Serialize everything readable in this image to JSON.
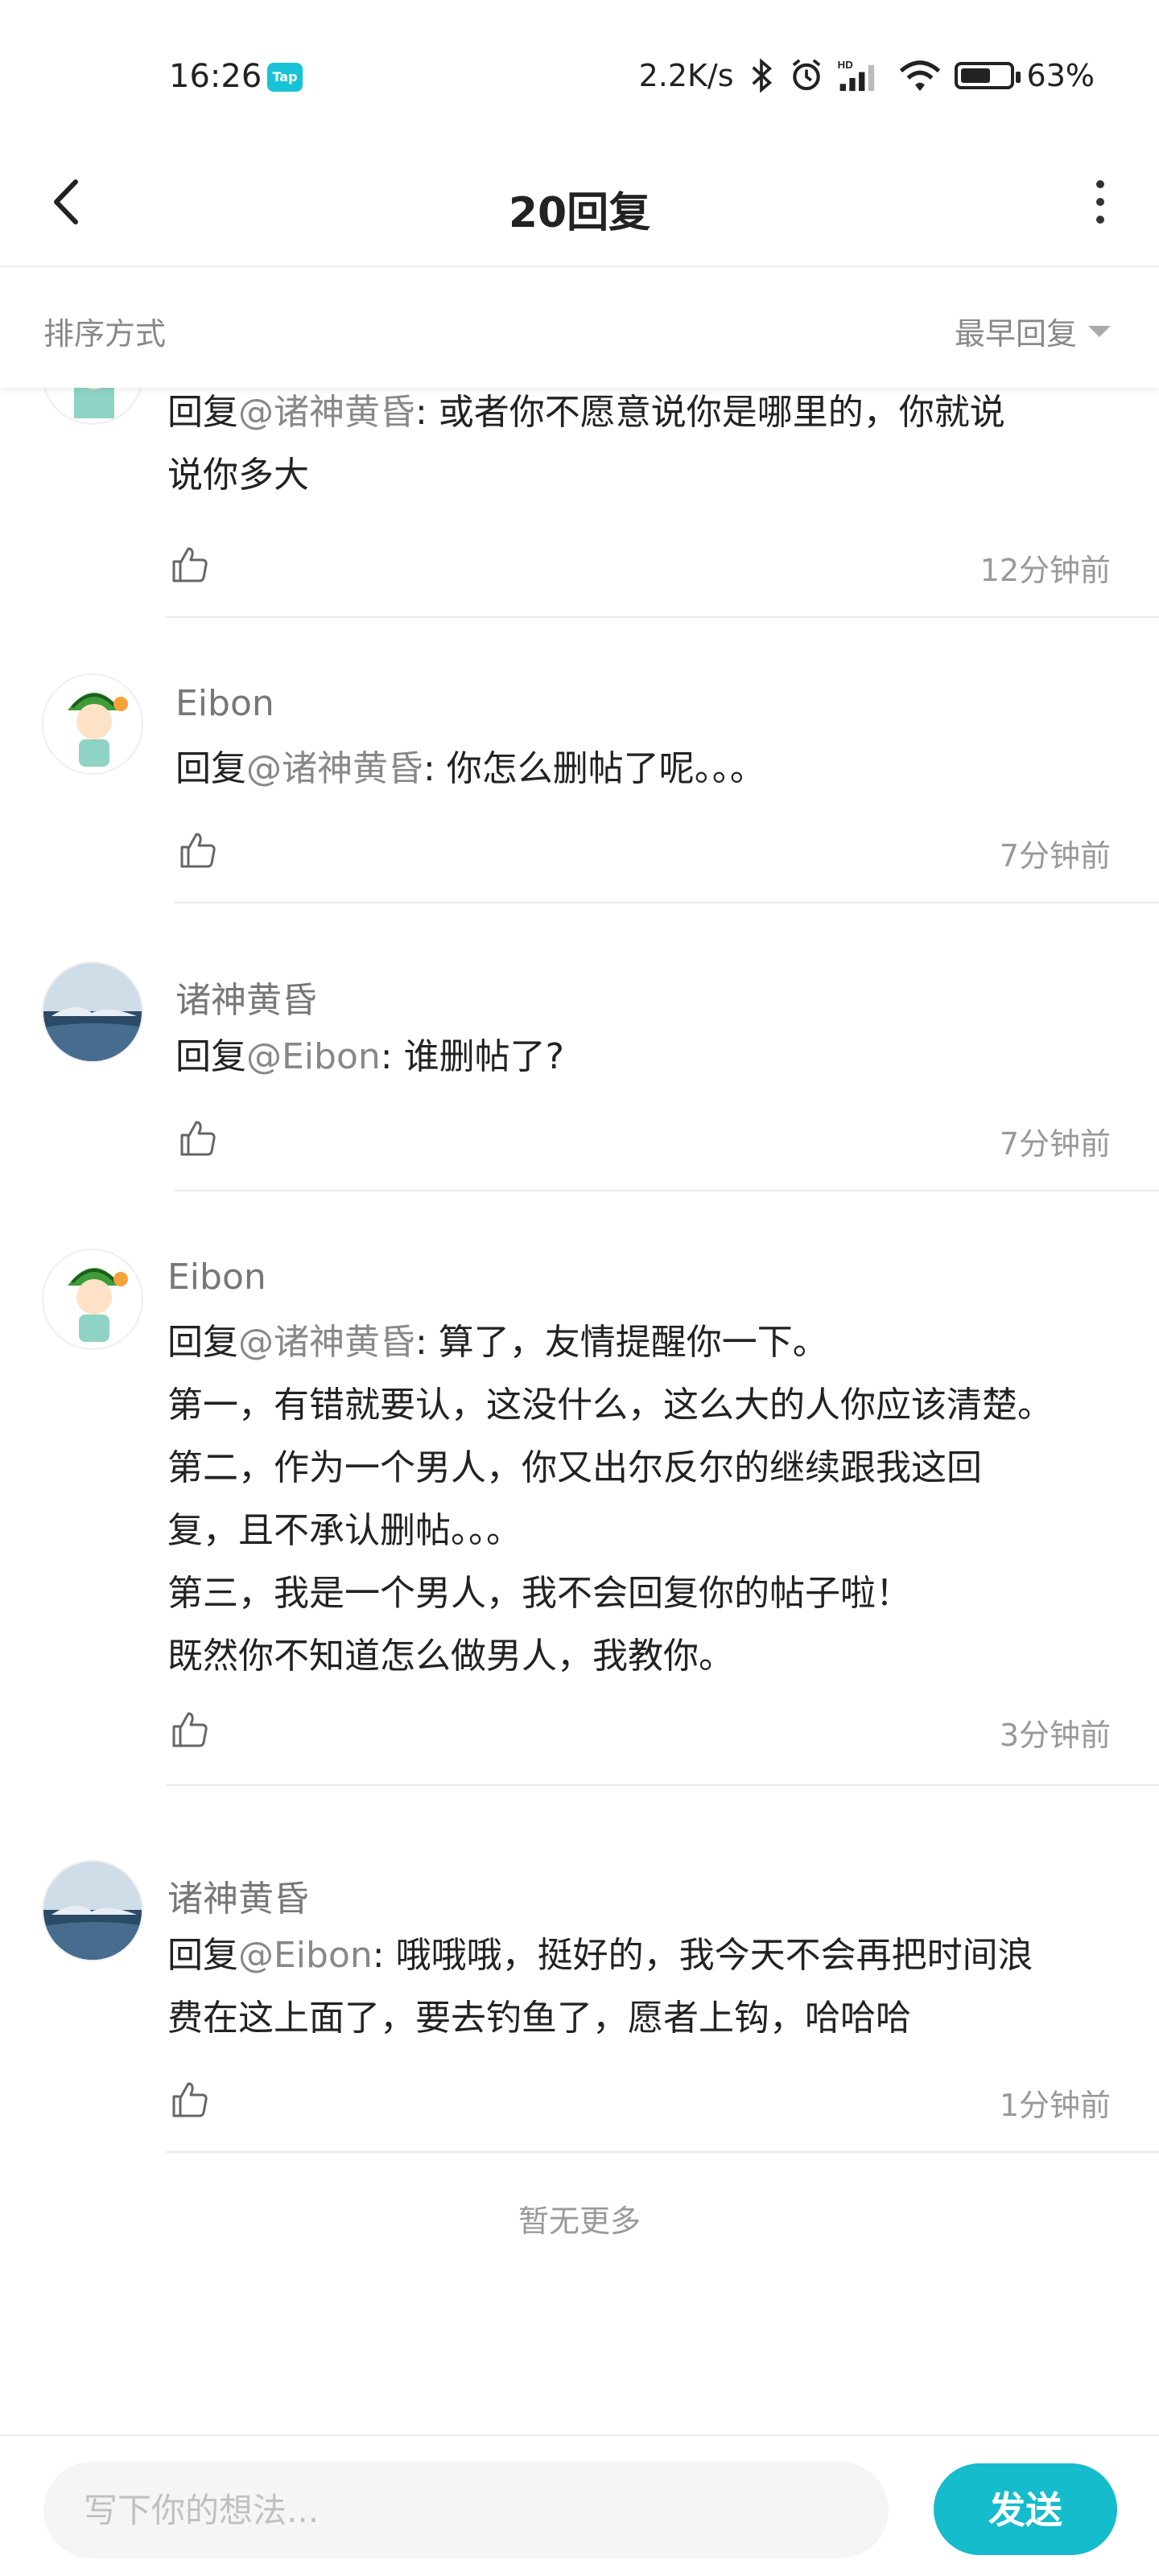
{
  "status_bar": {
    "time": "16:26",
    "app_badge": "Tap",
    "net_speed": "2.2K/s",
    "battery": "63%",
    "battery_level": 0.63,
    "icons": [
      "bluetooth-icon",
      "alarm-icon",
      "hd-signal-icon",
      "wifi-icon",
      "battery-icon"
    ]
  },
  "nav": {
    "title": "20回复",
    "back_icon": "chevron-left-icon",
    "more_icon": "more-vertical-icon"
  },
  "sort": {
    "label": "排序方式",
    "value": "最早回复"
  },
  "comments": [
    {
      "prefix": "回复",
      "mention": "@诸神黄昏",
      "body": ": 或者你不愿意说你是哪里的，你就说\n说你多大",
      "time": "12分钟前"
    },
    {
      "name": "Eibon",
      "prefix": "回复",
      "mention": "@诸神黄昏",
      "body": ": 你怎么删帖了呢。。。",
      "time": "7分钟前"
    },
    {
      "name": "诸神黄昏",
      "prefix": "回复",
      "mention": "@Eibon",
      "body": ": 谁删帖了?",
      "time": "7分钟前"
    },
    {
      "name": "Eibon",
      "prefix": "回复",
      "mention": "@诸神黄昏",
      "body": ": 算了，友情提醒你一下。\n第一，有错就要认，这没什么，这么大的人你应该清楚。\n第二，作为一个男人，你又出尔反尔的继续跟我这回\n复，且不承认删帖。。。\n第三，我是一个男人，我不会回复你的帖子啦！\n既然你不知道怎么做男人，我教你。",
      "time": "3分钟前"
    },
    {
      "name": "诸神黄昏",
      "prefix": "回复",
      "mention": "@Eibon",
      "body": ": 哦哦哦，挺好的，我今天不会再把时间浪\n费在这上面了，要去钓鱼了，愿者上钩，哈哈哈",
      "time": "1分钟前"
    }
  ],
  "footer_text": "暂无更多",
  "composer": {
    "placeholder": "写下你的想法...",
    "send_label": "发送"
  },
  "colors": {
    "accent": "#15bccb",
    "mention": "#888888",
    "muted": "#999999"
  }
}
